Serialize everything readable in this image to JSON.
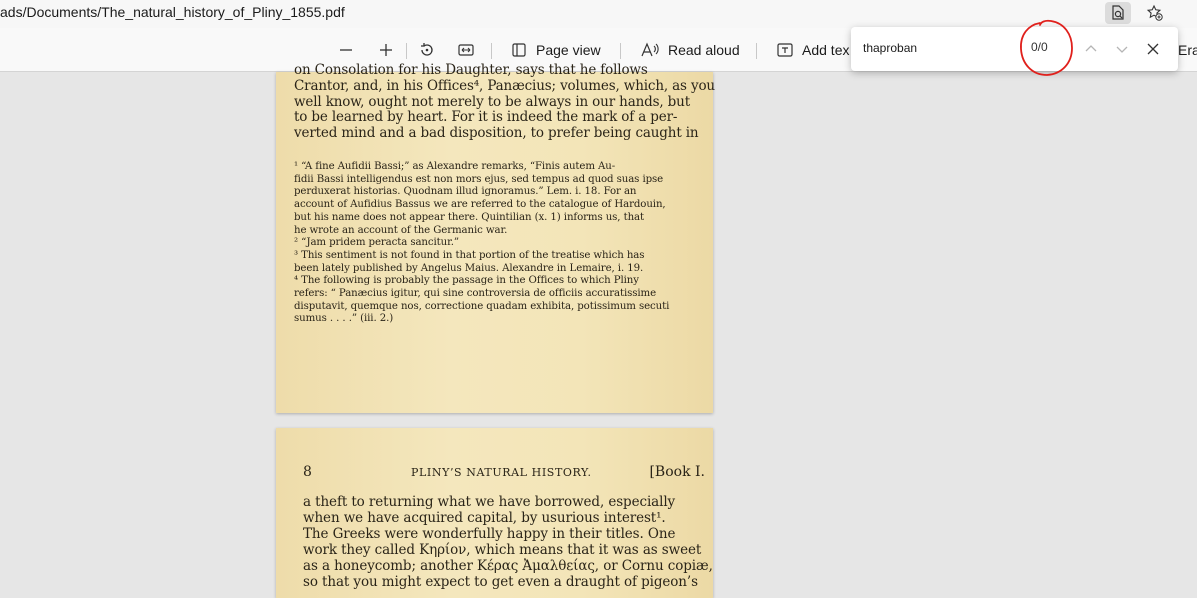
{
  "address_bar": {
    "url": "ads/Documents/The_natural_history_of_Pliny_1855.pdf",
    "icons": [
      "find-in-page-icon",
      "favorites-add-icon"
    ]
  },
  "toolbar": {
    "zoom_out_icon": "minus-icon",
    "zoom_in_icon": "plus-icon",
    "rotate_icon": "rotate-icon",
    "fit_icon": "fit-width-icon",
    "page_view_label": "Page view",
    "read_aloud_label": "Read aloud",
    "add_text_label": "Add tex",
    "erase_label": "Era"
  },
  "find": {
    "query": "thaproban",
    "count": "0/0"
  },
  "page1": {
    "body_lines": [
      "on Consolation for his Daughter, says that he follows",
      "Crantor, and, in his Offices⁴, Panæcius; volumes, which, as you",
      "well know, ought not merely to be always in our hands, but",
      "to be learned by heart.   For it is indeed the mark of a per-",
      "verted mind and a bad disposition, to prefer being caught in"
    ],
    "footnotes": [
      "¹ “A fine Aufidii Bassi;” as Alexandre remarks, “Finis autem Au-",
      "fidii Bassi intelligendus est non mors ejus, sed tempus ad quod suas ipse",
      "perduxerat historias.   Quodnam illud ignoramus.”   Lem. i. 18.   For an",
      "account of Aufidius Bassus we are referred to the catalogue of Hardouin,",
      "but his name does not appear there.   Quintilian (x. 1) informs us, that",
      "he wrote an account of the Germanic war.",
      "² “Jam pridem peracta sancitur.”",
      "³ This sentiment is not found in that portion of the treatise which has",
      "been lately published by Angelus Maius.   Alexandre in Lemaire, i. 19.",
      "⁴ The following is probably the passage in the Offices to which Pliny",
      "refers: “ Panæcius igitur, qui sine controversia de officiis accuratissime",
      "disputavit, quemque nos, correctione quadam exhibita, potissimum secuti",
      "sumus . . . .” (iii. 2.)"
    ]
  },
  "page2": {
    "page_number": "8",
    "running_title": "PLINY’S NATURAL HISTORY.",
    "book": "[Book I.",
    "body_lines": [
      "a theft to returning what we have borrowed, especially",
      "when we have acquired capital, by usurious interest¹.",
      "   The Greeks were wonderfully happy in their titles.   One",
      "work they called Κηρίον, which means that it was as sweet",
      "as a honeycomb; another Κέρας Ἀμαλθείας, or Cornu copiæ,",
      "so that you might expect to get even a draught of pigeon’s"
    ]
  },
  "colors": {
    "annotation": "#e0201c",
    "paper": "#f2e3b4",
    "viewer_bg": "#e6e6e6"
  }
}
